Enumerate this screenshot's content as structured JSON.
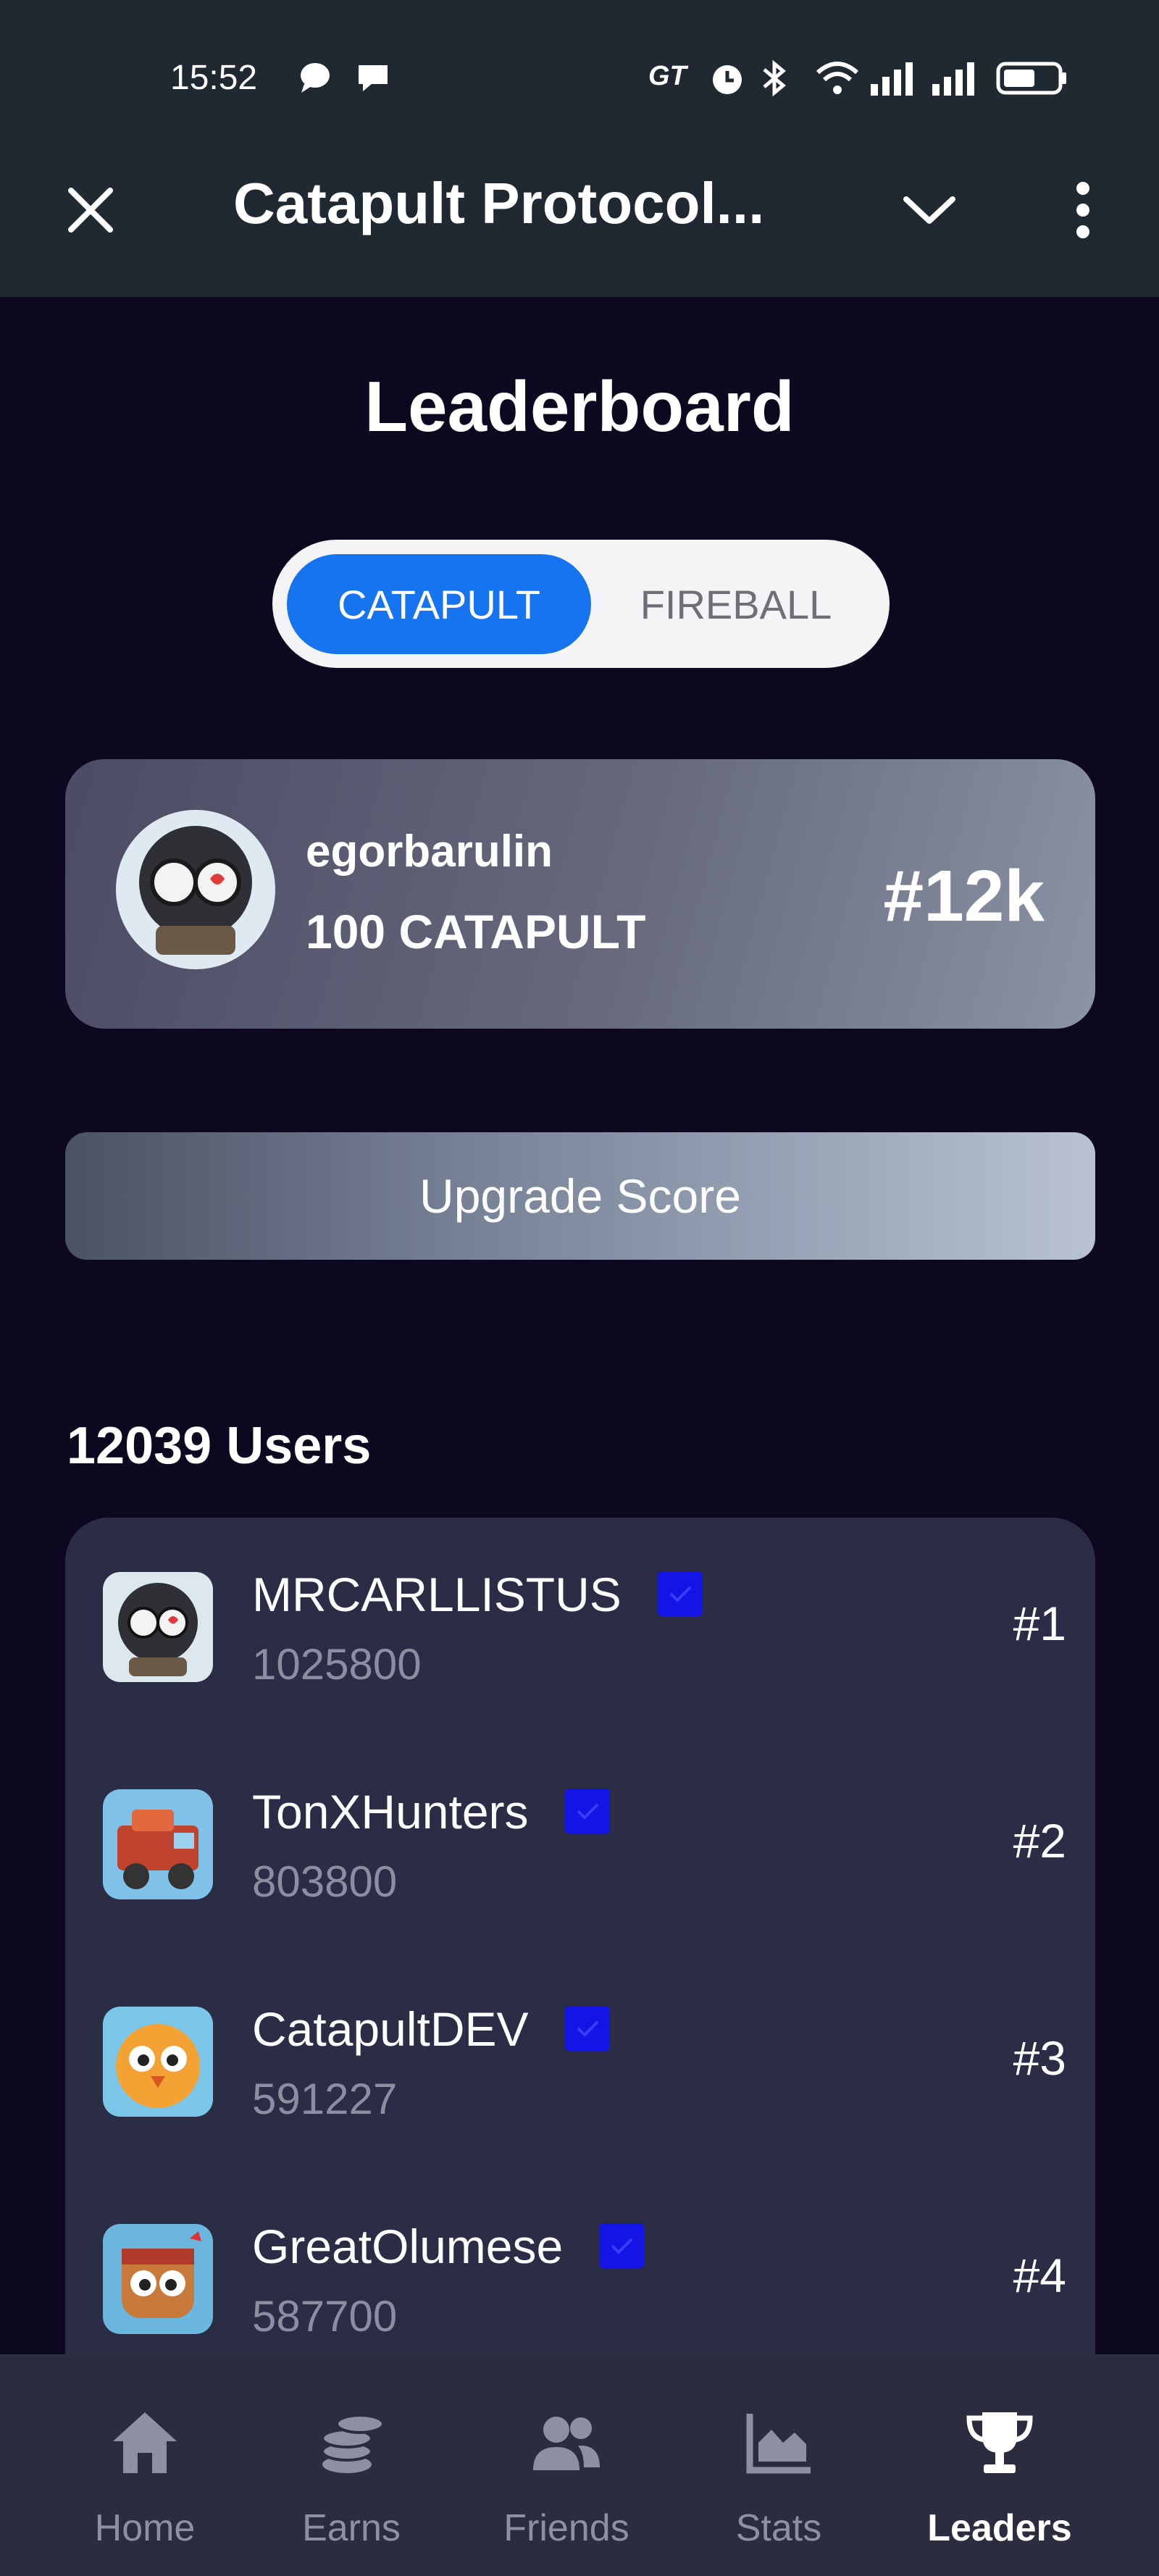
{
  "status_bar": {
    "time": "15:52",
    "network_label": "GT"
  },
  "window": {
    "title": "Catapult Protocol..."
  },
  "page": {
    "title": "Leaderboard"
  },
  "toggle": {
    "options": [
      "CATAPULT",
      "FIREBALL"
    ],
    "selected": "CATAPULT"
  },
  "me": {
    "name": "egorbarulin",
    "score": "100 CATAPULT",
    "rank": "#12k"
  },
  "upgrade_label": "Upgrade Score",
  "users_count": "12039 Users",
  "leaders": [
    {
      "name": "MRCARLLISTUS",
      "score": "1025800",
      "rank": "#1"
    },
    {
      "name": "TonXHunters",
      "score": "803800",
      "rank": "#2"
    },
    {
      "name": "CatapultDEV",
      "score": "591227",
      "rank": "#3"
    },
    {
      "name": "GreatOlumese",
      "score": "587700",
      "rank": "#4"
    }
  ],
  "nav": [
    {
      "label": "Home",
      "icon": "home-icon"
    },
    {
      "label": "Earns",
      "icon": "coins-icon"
    },
    {
      "label": "Friends",
      "icon": "friends-icon"
    },
    {
      "label": "Stats",
      "icon": "stats-icon"
    },
    {
      "label": "Leaders",
      "icon": "trophy-icon",
      "active": true
    }
  ],
  "colors": {
    "background": "#0e0720",
    "accent": "#1674f1",
    "verified": "#1414e6",
    "bar": "#202831",
    "list_bg": "#2b2c45"
  }
}
